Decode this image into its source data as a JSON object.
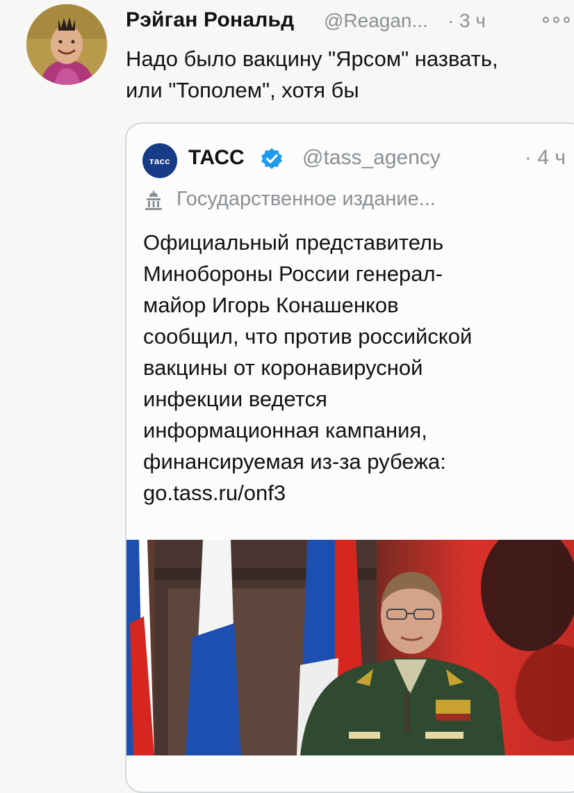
{
  "tweet": {
    "author_name": "Рэйган Рональд",
    "author_handle": "@Reagan...",
    "separator": "·",
    "time": "3 ч",
    "text_lines": [
      "Надо было вакцину \"Ярсом\" назвать,",
      "или \"Тополем\", хотя бы"
    ]
  },
  "quoted_tweet": {
    "logo_text": "тасс",
    "author_name": "ТАСС",
    "author_handle": "@tass_agency",
    "time": "· 4 ч",
    "label": "Государственное издание...",
    "text_lines": [
      "Официальный представитель",
      "Минобороны России генерал-",
      "майор Игорь Конашенков",
      "сообщил, что против российской",
      "вакцины от коронавирусной",
      "инфекции ведется",
      "информационная кампания,",
      "финансируемая из-за рубежа:",
      "go.tass.ru/onf3"
    ]
  },
  "colors": {
    "muted": "#8a9095",
    "verified_blue": "#1d9bf0",
    "tass_blue": "#173b86",
    "border": "#d3d7da"
  },
  "icons": [
    "more-options-icon",
    "verified-badge-icon",
    "government-building-icon"
  ]
}
